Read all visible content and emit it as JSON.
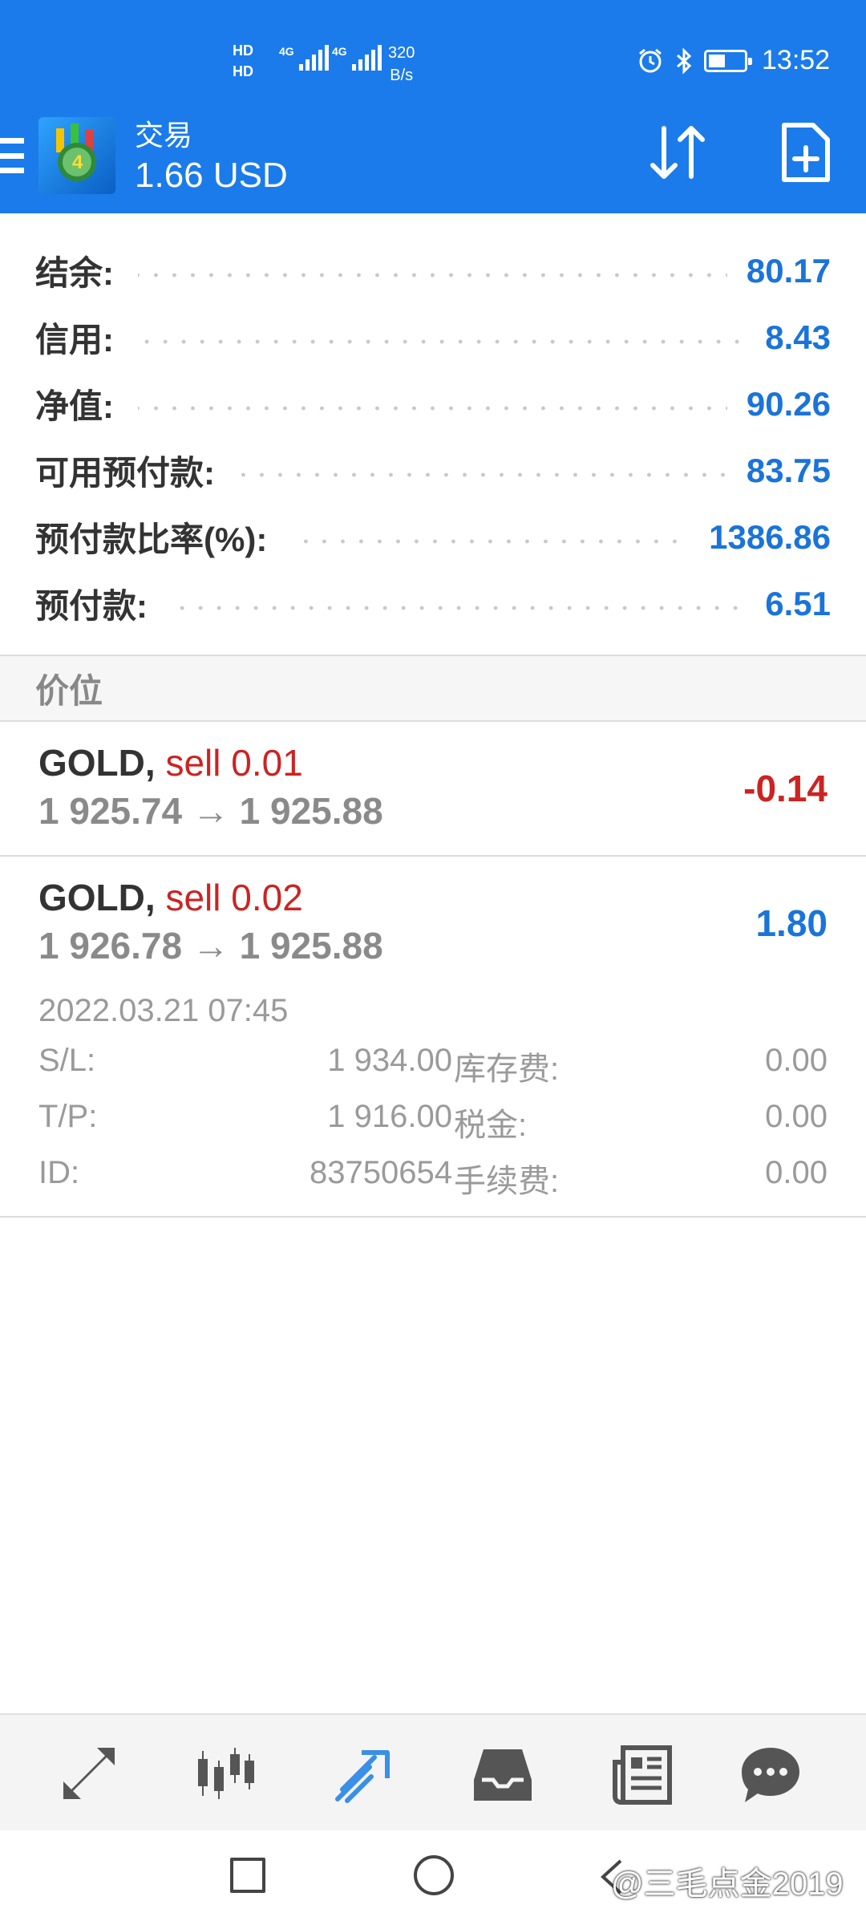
{
  "status_bar": {
    "hd1": "HD",
    "hd2": "HD",
    "net1": "4G",
    "net2": "4G",
    "speed_value": "320",
    "speed_unit": "B/s",
    "time": "13:52"
  },
  "header": {
    "title": "交易",
    "balance": "1.66 USD"
  },
  "account": {
    "rows": [
      {
        "label": "结余:",
        "value": "80.17"
      },
      {
        "label": "信用:",
        "value": "8.43"
      },
      {
        "label": "净值:",
        "value": "90.26"
      },
      {
        "label": "可用预付款:",
        "value": "83.75"
      },
      {
        "label": "预付款比率(%):",
        "value": "1386.86"
      },
      {
        "label": "预付款:",
        "value": "6.51"
      }
    ]
  },
  "section_title": "价位",
  "positions": [
    {
      "symbol": "GOLD,",
      "side": "sell 0.01",
      "prices": "1 925.74 → 1 925.88",
      "profit": "-0.14"
    },
    {
      "symbol": "GOLD,",
      "side": "sell 0.02",
      "prices": "1 926.78 → 1 925.88",
      "profit": "1.80",
      "open_time": "2022.03.21 07:45",
      "details": [
        {
          "k1": "S/L:",
          "v1": "1 934.00",
          "k2": "库存费:",
          "v2": "0.00"
        },
        {
          "k1": "T/P:",
          "v1": "1 916.00",
          "k2": "税金:",
          "v2": "0.00"
        },
        {
          "k1": "ID:",
          "v1": "83750654",
          "k2": "手续费:",
          "v2": "0.00"
        }
      ]
    }
  ],
  "colors": {
    "header_blue": "#1b7bea",
    "value_blue": "#1a74d9",
    "loss_red": "#cc2323",
    "active_nav": "#3a8fe6",
    "inactive_nav": "#555555"
  },
  "bottom_nav": [
    "quotes-icon",
    "chart-icon",
    "trade-icon",
    "history-icon",
    "news-icon",
    "messages-icon"
  ],
  "watermark": "@三毛点金2019"
}
